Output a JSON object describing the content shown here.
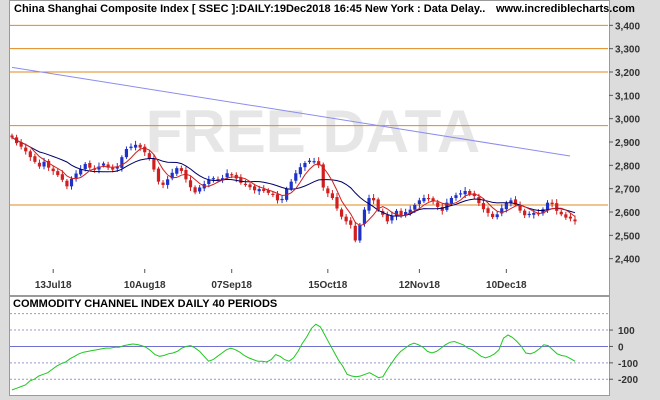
{
  "header": {
    "title": "China Shanghai Composite Index [ SSEC ]:DAILY:19Dec2018 16:45 New York : Data Delay..",
    "site": "www.incrediblecharts.com",
    "watermark": "FREE DATA"
  },
  "cci_panel": {
    "title": "COMMODITY CHANNEL INDEX DAILY 40 PERIODS"
  },
  "colors": {
    "background": "#dcdcdc",
    "panel": "#ffffff",
    "candle_up": "#1f32c8",
    "candle_down": "#d21e1e",
    "ma_short": "#d21e1e",
    "ma_long": "#00006a",
    "trendline": "#8c8cf0",
    "hlines": "#e08a1e",
    "cci_line": "#1ec81e",
    "watermark": "#e6e6e6"
  },
  "chart_data": [
    {
      "type": "candlestick",
      "title": "China Shanghai Composite Index [ SSEC ]:DAILY:19Dec2018 16:45 New York : Data Delay..",
      "x_tick_labels": [
        "13Jul18",
        "10Aug18",
        "07Sep18",
        "15Oct18",
        "12Nov18",
        "10Dec18"
      ],
      "x_tick_index": [
        9,
        29,
        48,
        69,
        89,
        108
      ],
      "y_tick_labels": [
        "3,400",
        "3,300",
        "3,200",
        "3,100",
        "3,000",
        "2,900",
        "2,800",
        "2,700",
        "2,600",
        "2,500",
        "2,400"
      ],
      "y_ticks": [
        3400,
        3300,
        3200,
        3100,
        3000,
        2900,
        2800,
        2700,
        2600,
        2500,
        2400
      ],
      "ylim": [
        2360,
        3440
      ],
      "horizontal_lines": [
        3400,
        3300,
        3200,
        2970,
        2630
      ],
      "trendline": {
        "start": 3220,
        "end": 2840
      },
      "moving_averages": [
        "short",
        "long"
      ],
      "closes": [
        2920,
        2895,
        2880,
        2860,
        2835,
        2815,
        2795,
        2815,
        2790,
        2775,
        2758,
        2738,
        2710,
        2742,
        2765,
        2784,
        2806,
        2790,
        2782,
        2795,
        2808,
        2790,
        2782,
        2793,
        2835,
        2870,
        2880,
        2888,
        2876,
        2856,
        2828,
        2782,
        2730,
        2716,
        2740,
        2768,
        2788,
        2776,
        2740,
        2706,
        2684,
        2705,
        2720,
        2738,
        2745,
        2735,
        2745,
        2766,
        2759,
        2744,
        2725,
        2718,
        2706,
        2693,
        2698,
        2690,
        2682,
        2676,
        2650,
        2656,
        2700,
        2730,
        2766,
        2792,
        2810,
        2820,
        2818,
        2800,
        2705,
        2680,
        2660,
        2615,
        2580,
        2560,
        2545,
        2478,
        2545,
        2610,
        2660,
        2650,
        2608,
        2588,
        2560,
        2585,
        2605,
        2582,
        2600,
        2610,
        2630,
        2650,
        2660,
        2655,
        2645,
        2622,
        2605,
        2640,
        2660,
        2672,
        2680,
        2690,
        2676,
        2668,
        2638,
        2612,
        2596,
        2578,
        2590,
        2616,
        2640,
        2650,
        2632,
        2606,
        2586,
        2592,
        2596,
        2590,
        2612,
        2640,
        2634,
        2605,
        2590,
        2576,
        2572,
        2560
      ]
    },
    {
      "type": "line",
      "title": "COMMODITY CHANNEL INDEX DAILY 40 PERIODS",
      "y_tick_labels": [
        "100",
        "0",
        "-100",
        "-200"
      ],
      "y_ticks": [
        100,
        0,
        -100,
        -200
      ],
      "ylim": [
        -290,
        210
      ],
      "reference_lines": [
        200,
        100,
        0,
        -100,
        -200
      ],
      "values": [
        -265,
        -255,
        -245,
        -235,
        -210,
        -200,
        -180,
        -170,
        -160,
        -140,
        -120,
        -105,
        -95,
        -75,
        -60,
        -45,
        -35,
        -30,
        -25,
        -20,
        -15,
        -10,
        -10,
        -5,
        -5,
        5,
        10,
        15,
        12,
        5,
        -5,
        -25,
        -50,
        -60,
        -55,
        -45,
        -40,
        -30,
        -10,
        0,
        5,
        -10,
        -30,
        -60,
        -90,
        -80,
        -60,
        -40,
        -20,
        -10,
        -20,
        -35,
        -55,
        -70,
        -80,
        -90,
        -90,
        -95,
        -80,
        -50,
        -60,
        -80,
        -90,
        -70,
        -30,
        20,
        60,
        110,
        135,
        120,
        70,
        20,
        -30,
        -80,
        -120,
        -170,
        -180,
        -185,
        -180,
        -170,
        -160,
        -175,
        -190,
        -185,
        -140,
        -100,
        -60,
        -30,
        -10,
        10,
        20,
        10,
        -5,
        -30,
        -40,
        -30,
        -10,
        10,
        25,
        30,
        20,
        10,
        -10,
        -20,
        -40,
        -60,
        -70,
        -60,
        -45,
        -20,
        50,
        70,
        55,
        30,
        0,
        -40,
        -45,
        -35,
        -15,
        10,
        5,
        -20,
        -45,
        -55,
        -60,
        -75,
        -90
      ]
    }
  ]
}
